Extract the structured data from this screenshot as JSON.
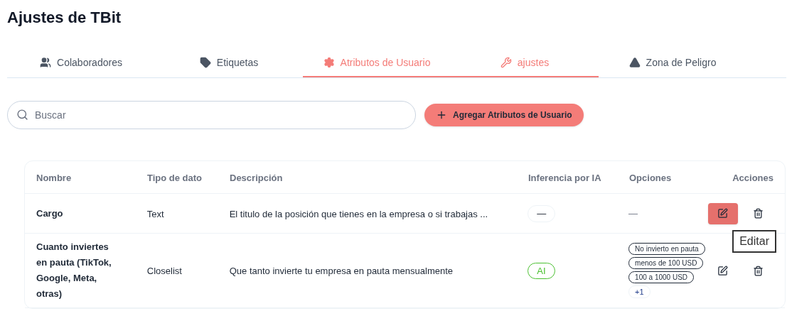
{
  "title": "Ajustes de TBit",
  "tabs": [
    {
      "label": "Colaboradores",
      "selected": false
    },
    {
      "label": "Etiquetas",
      "selected": false
    },
    {
      "label": "Atributos de Usuario",
      "selected": true
    },
    {
      "label": "ajustes",
      "selected": true
    },
    {
      "label": "Zona de Peligro",
      "selected": false
    }
  ],
  "search": {
    "placeholder": "Buscar"
  },
  "add_button": {
    "label": "Agregar Atributos de Usuario"
  },
  "table": {
    "columns": [
      "Nombre",
      "Tipo de dato",
      "Descripción",
      "Inferencia por IA",
      "Opciones",
      "Acciones"
    ],
    "rows": [
      {
        "name": "Cargo",
        "type": "Text",
        "description": "El titulo de la posición que tienes en la empresa o si trabajas ...",
        "inference": {
          "label": "—",
          "active": false
        },
        "options_empty": "—",
        "edit_hovered": true
      },
      {
        "name": "Cuanto inviertes en pauta (TikTok, Google, Meta, otras)",
        "type": "Closelist",
        "description": "Que tanto invierte tu empresa en pauta mensualmente",
        "inference": {
          "label": "AI",
          "active": true
        },
        "options": [
          "No invierto en pauta",
          "menos de 100 USD",
          "100 a 1000 USD"
        ],
        "more": "+1",
        "edit_hovered": false
      }
    ]
  },
  "tooltip": "Editar"
}
